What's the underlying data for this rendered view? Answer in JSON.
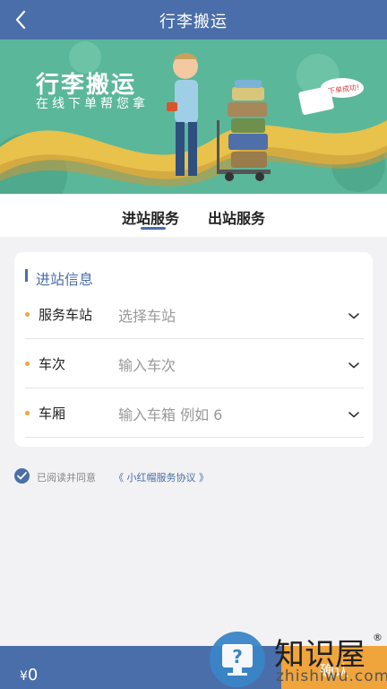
{
  "nav": {
    "title": "行李搬运"
  },
  "banner": {
    "title": "行李搬运",
    "subtitle": "在线下单帮您拿",
    "bubble": "下单成功!"
  },
  "tabs": [
    {
      "label": "进站服务",
      "active": true
    },
    {
      "label": "出站服务",
      "active": false
    }
  ],
  "form": {
    "section_title": "进站信息",
    "rows": [
      {
        "label": "服务车站",
        "placeholder": "选择车站"
      },
      {
        "label": "车次",
        "placeholder": "输入车次"
      },
      {
        "label": "车厢",
        "placeholder": "输入车箱 例如 6"
      }
    ]
  },
  "agreement": {
    "text": "已阅读并同意",
    "link": "《 小红帽服务协议 》",
    "checked": true
  },
  "footer": {
    "currency": "¥",
    "amount": "0",
    "confirm_label": "确认"
  },
  "watermark": {
    "name": "知识屋",
    "reg": "®",
    "url": "zhishiwu.com"
  },
  "colors": {
    "primary": "#4a6ea9",
    "accent": "#f0a43c",
    "banner_bg": "#5bb79a"
  }
}
